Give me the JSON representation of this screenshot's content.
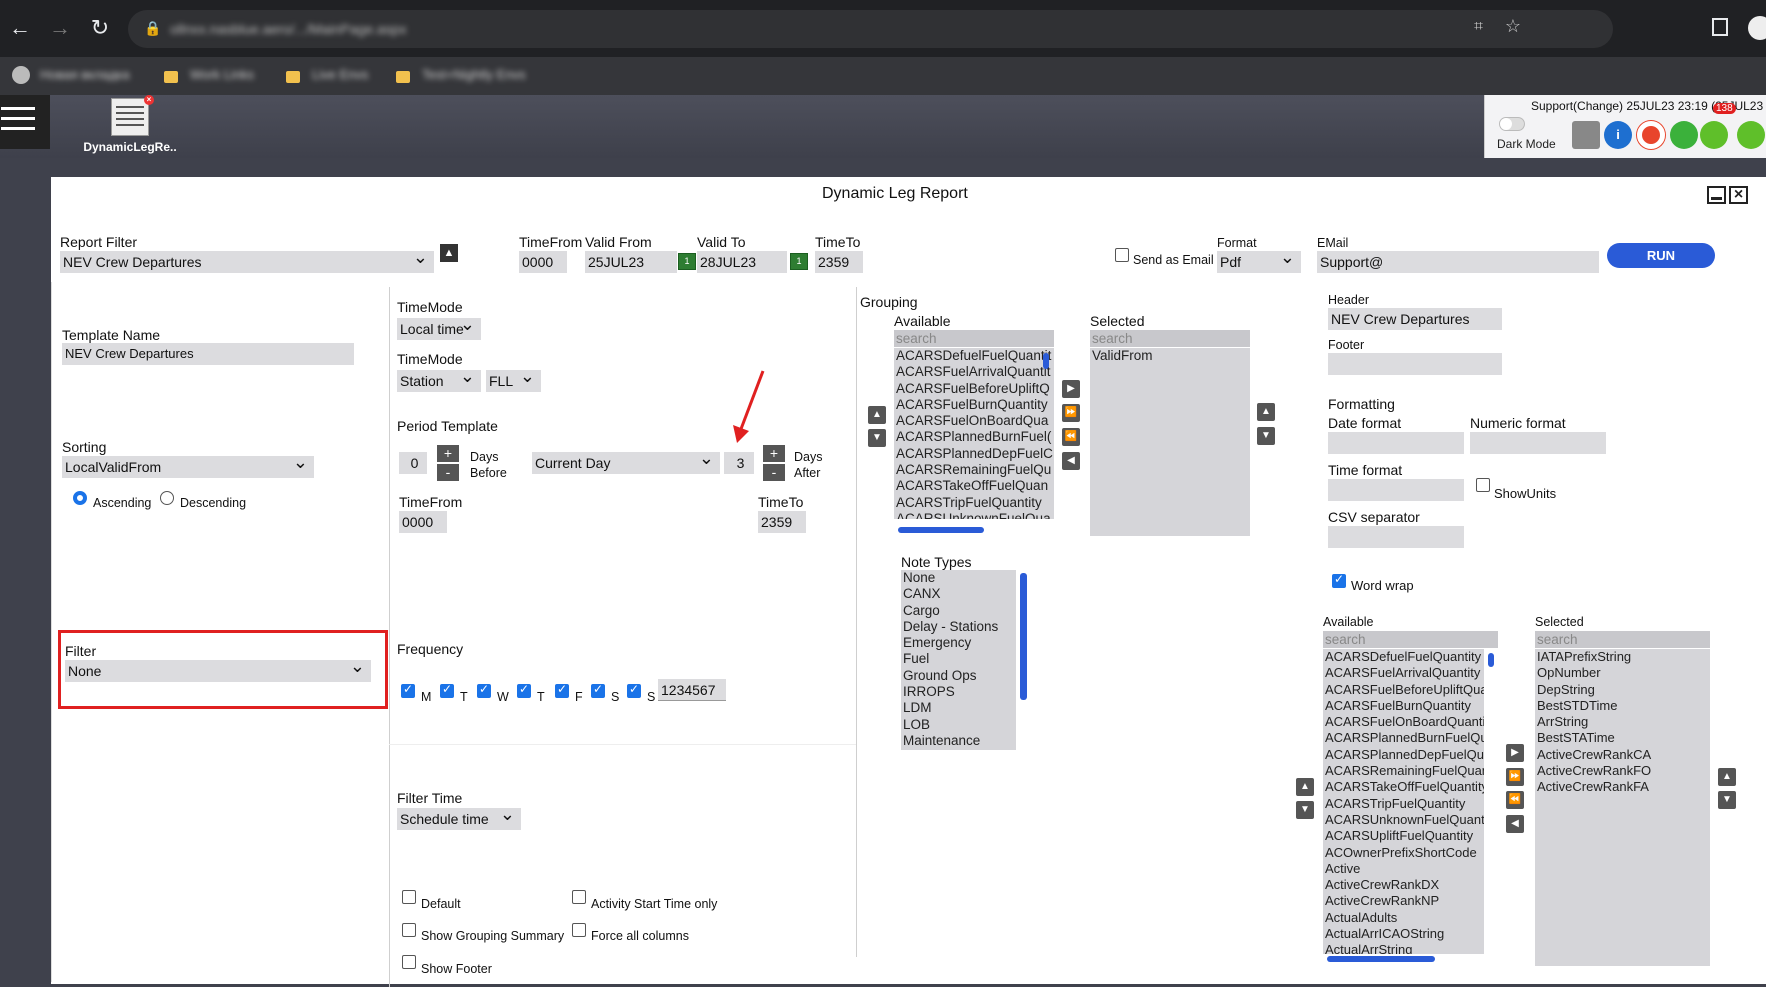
{
  "browser": {
    "url": "ollnxx.nasblue.aero/.../MainPage.aspx",
    "bookmarks": [
      "Новая вкладка",
      "Work Links",
      "Live Envs",
      "Test+Nightly Envs"
    ]
  },
  "app": {
    "doc_tab_label": "DynamicLegRe..",
    "support_text": "Support(Change) 25JUL23 23:19 (25JUL23",
    "dark_mode_label": "Dark Mode",
    "badge_count": "138"
  },
  "dialog": {
    "title": "Dynamic Leg Report",
    "report_filter_label": "Report Filter",
    "report_filter_value": "NEV Crew Departures",
    "timefrom_label": "TimeFrom",
    "timefrom_value": "0000",
    "validfrom_label": "Valid From",
    "validfrom_value": "25JUL23",
    "validto_label": "Valid To",
    "validto_value": "28JUL23",
    "timeto_label": "TimeTo",
    "timeto_value": "2359",
    "send_email_label": "Send as Email",
    "format_label": "Format",
    "format_value": "Pdf",
    "email_label": "EMail",
    "email_value": "Support@",
    "run_label": "RUN"
  },
  "left": {
    "template_name_label": "Template Name",
    "template_name_value": "NEV Crew Departures",
    "sorting_label": "Sorting",
    "sorting_value": "LocalValidFrom",
    "ascending_label": "Ascending",
    "descending_label": "Descending",
    "filter_label": "Filter",
    "filter_value": "None"
  },
  "middle": {
    "timemode1_label": "TimeMode",
    "timemode1_value": "Local time",
    "timemode2_label": "TimeMode",
    "timemode2_value": "Station",
    "station_value": "FLL",
    "period_label": "Period Template",
    "days_before_value": "0",
    "days_label": "Days",
    "before_label": "Before",
    "after_label": "After",
    "period_value": "Current Day",
    "days_after_value": "3",
    "ptimefrom_label": "TimeFrom",
    "ptimefrom_value": "0000",
    "ptimeto_label": "TimeTo",
    "ptimeto_value": "2359",
    "frequency_label": "Frequency",
    "freq_days": [
      "M",
      "T",
      "W",
      "T",
      "F",
      "S",
      "S"
    ],
    "freq_value": "1234567",
    "filter_time_label": "Filter Time",
    "filter_time_value": "Schedule time",
    "default_label": "Default",
    "activity_start_label": "Activity Start Time only",
    "grouping_summary_label": "Show Grouping Summary",
    "force_columns_label": "Force all columns",
    "show_footer_label": "Show Footer"
  },
  "grouping": {
    "label": "Grouping",
    "available_label": "Available",
    "selected_label": "Selected",
    "search_placeholder": "search",
    "available": [
      "ACARSDefuelFuelQuantit",
      "ACARSFuelArrivalQuantit",
      "ACARSFuelBeforeUpliftQ",
      "ACARSFuelBurnQuantity",
      "ACARSFuelOnBoardQua",
      "ACARSPlannedBurnFuel(",
      "ACARSPlannedDepFuelC",
      "ACARSRemainingFuelQu",
      "ACARSTakeOffFuelQuan",
      "ACARSTripFuelQuantity",
      "ACARSUnknownFuelQua"
    ],
    "selected": [
      "ValidFrom"
    ]
  },
  "notes": {
    "label": "Note Types",
    "items": [
      "None",
      "CANX",
      "Cargo",
      "Delay - Stations",
      "Emergency",
      "Fuel",
      "Ground Ops",
      "IRROPS",
      "LDM",
      "LOB",
      "Maintenance"
    ]
  },
  "right": {
    "header_label": "Header",
    "header_value": "NEV Crew Departures",
    "footer_label": "Footer",
    "formatting_label": "Formatting",
    "date_format_label": "Date format",
    "numeric_format_label": "Numeric format",
    "time_format_label": "Time format",
    "show_units_label": "ShowUnits",
    "csv_label": "CSV separator",
    "word_wrap_label": "Word wrap"
  },
  "columns": {
    "available_label": "Available",
    "selected_label": "Selected",
    "search_placeholder": "search",
    "available": [
      "ACARSDefuelFuelQuantity",
      "ACARSFuelArrivalQuantity",
      "ACARSFuelBeforeUpliftQuar",
      "ACARSFuelBurnQuantity",
      "ACARSFuelOnBoardQuantit",
      "ACARSPlannedBurnFuelQua",
      "ACARSPlannedDepFuelQua",
      "ACARSRemainingFuelQuan",
      "ACARSTakeOffFuelQuantity",
      "ACARSTripFuelQuantity",
      "ACARSUnknownFuelQuantit",
      "ACARSUpliftFuelQuantity",
      "ACOwnerPrefixShortCode",
      "Active",
      "ActiveCrewRankDX",
      "ActiveCrewRankNP",
      "ActualAdults",
      "ActualArrICAOString",
      "ActualArrString"
    ],
    "selected": [
      "IATAPrefixString",
      "OpNumber",
      "DepString",
      "BestSTDTime",
      "ArrString",
      "BestSTATime",
      "ActiveCrewRankCA",
      "ActiveCrewRankFO",
      "ActiveCrewRankFA"
    ]
  },
  "colors": {
    "accent": "#2a5bd7",
    "highlight": "#e02020"
  }
}
